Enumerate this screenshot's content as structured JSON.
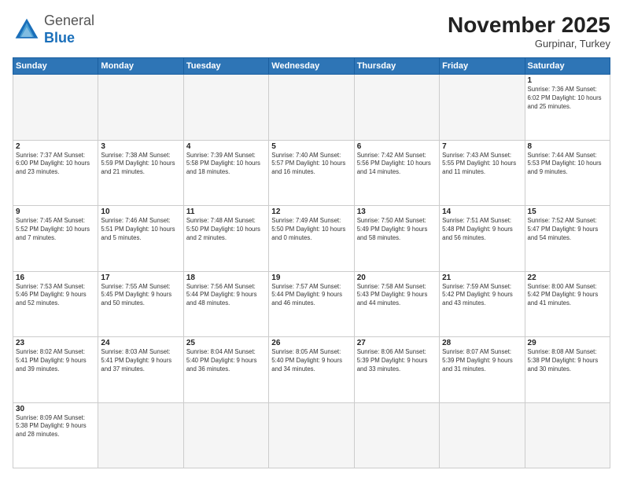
{
  "header": {
    "logo": {
      "general": "General",
      "blue": "Blue"
    },
    "title": "November 2025",
    "location": "Gurpinar, Turkey"
  },
  "days_of_week": [
    "Sunday",
    "Monday",
    "Tuesday",
    "Wednesday",
    "Thursday",
    "Friday",
    "Saturday"
  ],
  "weeks": [
    [
      {
        "day": "",
        "info": ""
      },
      {
        "day": "",
        "info": ""
      },
      {
        "day": "",
        "info": ""
      },
      {
        "day": "",
        "info": ""
      },
      {
        "day": "",
        "info": ""
      },
      {
        "day": "",
        "info": ""
      },
      {
        "day": "1",
        "info": "Sunrise: 7:36 AM\nSunset: 6:02 PM\nDaylight: 10 hours and 25 minutes."
      }
    ],
    [
      {
        "day": "2",
        "info": "Sunrise: 7:37 AM\nSunset: 6:00 PM\nDaylight: 10 hours and 23 minutes."
      },
      {
        "day": "3",
        "info": "Sunrise: 7:38 AM\nSunset: 5:59 PM\nDaylight: 10 hours and 21 minutes."
      },
      {
        "day": "4",
        "info": "Sunrise: 7:39 AM\nSunset: 5:58 PM\nDaylight: 10 hours and 18 minutes."
      },
      {
        "day": "5",
        "info": "Sunrise: 7:40 AM\nSunset: 5:57 PM\nDaylight: 10 hours and 16 minutes."
      },
      {
        "day": "6",
        "info": "Sunrise: 7:42 AM\nSunset: 5:56 PM\nDaylight: 10 hours and 14 minutes."
      },
      {
        "day": "7",
        "info": "Sunrise: 7:43 AM\nSunset: 5:55 PM\nDaylight: 10 hours and 11 minutes."
      },
      {
        "day": "8",
        "info": "Sunrise: 7:44 AM\nSunset: 5:53 PM\nDaylight: 10 hours and 9 minutes."
      }
    ],
    [
      {
        "day": "9",
        "info": "Sunrise: 7:45 AM\nSunset: 5:52 PM\nDaylight: 10 hours and 7 minutes."
      },
      {
        "day": "10",
        "info": "Sunrise: 7:46 AM\nSunset: 5:51 PM\nDaylight: 10 hours and 5 minutes."
      },
      {
        "day": "11",
        "info": "Sunrise: 7:48 AM\nSunset: 5:50 PM\nDaylight: 10 hours and 2 minutes."
      },
      {
        "day": "12",
        "info": "Sunrise: 7:49 AM\nSunset: 5:50 PM\nDaylight: 10 hours and 0 minutes."
      },
      {
        "day": "13",
        "info": "Sunrise: 7:50 AM\nSunset: 5:49 PM\nDaylight: 9 hours and 58 minutes."
      },
      {
        "day": "14",
        "info": "Sunrise: 7:51 AM\nSunset: 5:48 PM\nDaylight: 9 hours and 56 minutes."
      },
      {
        "day": "15",
        "info": "Sunrise: 7:52 AM\nSunset: 5:47 PM\nDaylight: 9 hours and 54 minutes."
      }
    ],
    [
      {
        "day": "16",
        "info": "Sunrise: 7:53 AM\nSunset: 5:46 PM\nDaylight: 9 hours and 52 minutes."
      },
      {
        "day": "17",
        "info": "Sunrise: 7:55 AM\nSunset: 5:45 PM\nDaylight: 9 hours and 50 minutes."
      },
      {
        "day": "18",
        "info": "Sunrise: 7:56 AM\nSunset: 5:44 PM\nDaylight: 9 hours and 48 minutes."
      },
      {
        "day": "19",
        "info": "Sunrise: 7:57 AM\nSunset: 5:44 PM\nDaylight: 9 hours and 46 minutes."
      },
      {
        "day": "20",
        "info": "Sunrise: 7:58 AM\nSunset: 5:43 PM\nDaylight: 9 hours and 44 minutes."
      },
      {
        "day": "21",
        "info": "Sunrise: 7:59 AM\nSunset: 5:42 PM\nDaylight: 9 hours and 43 minutes."
      },
      {
        "day": "22",
        "info": "Sunrise: 8:00 AM\nSunset: 5:42 PM\nDaylight: 9 hours and 41 minutes."
      }
    ],
    [
      {
        "day": "23",
        "info": "Sunrise: 8:02 AM\nSunset: 5:41 PM\nDaylight: 9 hours and 39 minutes."
      },
      {
        "day": "24",
        "info": "Sunrise: 8:03 AM\nSunset: 5:41 PM\nDaylight: 9 hours and 37 minutes."
      },
      {
        "day": "25",
        "info": "Sunrise: 8:04 AM\nSunset: 5:40 PM\nDaylight: 9 hours and 36 minutes."
      },
      {
        "day": "26",
        "info": "Sunrise: 8:05 AM\nSunset: 5:40 PM\nDaylight: 9 hours and 34 minutes."
      },
      {
        "day": "27",
        "info": "Sunrise: 8:06 AM\nSunset: 5:39 PM\nDaylight: 9 hours and 33 minutes."
      },
      {
        "day": "28",
        "info": "Sunrise: 8:07 AM\nSunset: 5:39 PM\nDaylight: 9 hours and 31 minutes."
      },
      {
        "day": "29",
        "info": "Sunrise: 8:08 AM\nSunset: 5:38 PM\nDaylight: 9 hours and 30 minutes."
      }
    ],
    [
      {
        "day": "30",
        "info": "Sunrise: 8:09 AM\nSunset: 5:38 PM\nDaylight: 9 hours and 28 minutes."
      },
      {
        "day": "",
        "info": ""
      },
      {
        "day": "",
        "info": ""
      },
      {
        "day": "",
        "info": ""
      },
      {
        "day": "",
        "info": ""
      },
      {
        "day": "",
        "info": ""
      },
      {
        "day": "",
        "info": ""
      }
    ]
  ]
}
